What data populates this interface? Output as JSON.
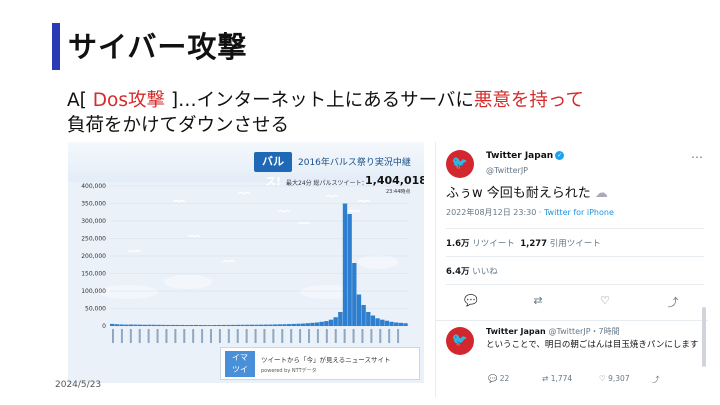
{
  "slide": {
    "title": "サイバー攻撃",
    "line1_a": "A[ ",
    "line1_b": "Dos攻撃",
    "line1_c": " ]…インターネット上にあるサーバに",
    "line1_d": "悪意を持って",
    "line2": "負荷をかけてダウンさせる",
    "date": "2024/5/23",
    "colors": {
      "accent": "#2b3ab5",
      "highlight": "#d62b2b"
    }
  },
  "chart_image": {
    "logo": "バルス!",
    "header": "2016年バルス祭り実況中継",
    "counter_label": "最大24分 総パルスツイート：",
    "counter_value": "1,404,018",
    "counter_sub": "23:44時点",
    "footer_logo_1": "イマ",
    "footer_logo_2": "ツイ",
    "footer_text": "ツイートから「今」が見えるニュースサイト",
    "footer_small": "powered by NTTデータ"
  },
  "chart_data": {
    "type": "bar",
    "title": "",
    "xlabel": "",
    "ylabel": "",
    "ylim": [
      0,
      400000
    ],
    "yticks": [
      "400,000",
      "350,000",
      "300,000",
      "250,000",
      "200,000",
      "150,000",
      "100,000",
      "50,000",
      "0"
    ],
    "values": [
      6000,
      5000,
      4500,
      4000,
      4200,
      4000,
      3800,
      3500,
      3600,
      3400,
      3300,
      3200,
      3000,
      3100,
      3000,
      2900,
      2800,
      2900,
      3000,
      2800,
      2700,
      2600,
      2800,
      2900,
      3000,
      3100,
      3200,
      3300,
      3400,
      3500,
      3600,
      3700,
      3800,
      4000,
      4200,
      4500,
      4800,
      5000,
      5500,
      6000,
      6500,
      7000,
      8000,
      9000,
      10000,
      12000,
      14000,
      18000,
      25000,
      40000,
      350000,
      320000,
      180000,
      90000,
      60000,
      40000,
      30000,
      22000,
      18000,
      15000,
      12000,
      10000,
      9000,
      8000
    ],
    "grid": true
  },
  "tweet": {
    "name": "Twitter Japan",
    "handle": "@TwitterJP",
    "text": "ふぅw 今回も耐えられた",
    "timestamp": "2022年08月12日 23:30",
    "source": "Twitter for iPhone",
    "retweets_num": "1.6万",
    "retweets_label": "リツイート",
    "quotes_num": "1,277",
    "quotes_label": "引用ツイート",
    "likes_num": "6.4万",
    "likes_label": "いいね",
    "reply": {
      "name": "Twitter Japan",
      "meta": "@TwitterJP・7時間",
      "text": "ということで、明日の朝ごはんは目玉焼きパンにします",
      "replies": "22",
      "retweets": "1,774",
      "likes": "9,307"
    }
  }
}
